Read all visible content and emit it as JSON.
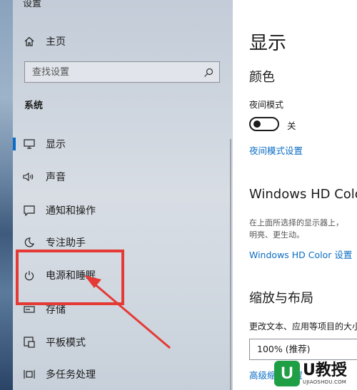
{
  "sidebar": {
    "window_title": "设置",
    "home_label": "主页",
    "search_placeholder": "查找设置",
    "section_title": "系统",
    "items": [
      {
        "label": "显示",
        "icon": "monitor-icon"
      },
      {
        "label": "声音",
        "icon": "speaker-icon"
      },
      {
        "label": "通知和操作",
        "icon": "notification-icon"
      },
      {
        "label": "专注助手",
        "icon": "moon-icon"
      },
      {
        "label": "电源和睡眠",
        "icon": "power-icon"
      },
      {
        "label": "存储",
        "icon": "storage-icon"
      },
      {
        "label": "平板模式",
        "icon": "tablet-icon"
      },
      {
        "label": "多任务处理",
        "icon": "multitask-icon"
      }
    ],
    "selected": "显示"
  },
  "main": {
    "page_title": "显示",
    "color_heading": "颜色",
    "night_mode_label": "夜间模式",
    "night_mode_state": "关",
    "night_mode_settings_link": "夜间模式设置",
    "hd_heading": "Windows HD Color",
    "hd_desc_line1": "在上面所选择的显示器上，",
    "hd_desc_line2": "明亮、更生动。",
    "hd_settings_link": "Windows HD Color 设置",
    "scale_heading": "缩放与布局",
    "scale_desc": "更改文本、应用等项目的大小",
    "scale_value": "100% (推荐)",
    "advanced_link": "高级缩放设置"
  },
  "watermark": {
    "big": "U教授",
    "small": "UJIAOSHOU.COM"
  },
  "colors": {
    "accent": "#0a6cc4",
    "highlight": "#e53935"
  }
}
